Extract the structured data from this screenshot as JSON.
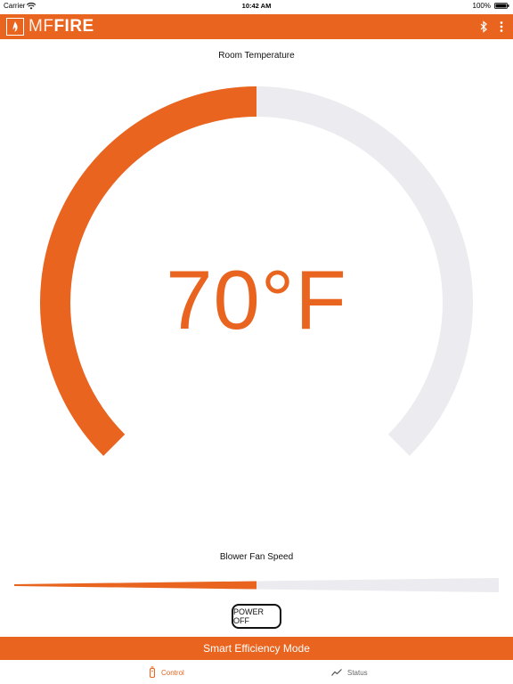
{
  "status_bar": {
    "carrier": "Carrier",
    "time": "10:42 AM",
    "battery": "100%"
  },
  "header": {
    "logo_mf": "MF",
    "logo_fire": "FIRE",
    "icons": [
      "flame-logo-icon",
      "bluetooth-icon",
      "more-vertical-icon"
    ]
  },
  "thermostat": {
    "label": "Room Temperature",
    "temperature": "70°F",
    "dial_fill_fraction": 0.5
  },
  "fan": {
    "label": "Blower Fan Speed",
    "fill_fraction": 0.5
  },
  "power_button": {
    "label": "POWER OFF"
  },
  "smart_bar": {
    "label": "Smart Efficiency Mode"
  },
  "tabs": [
    {
      "label": "Control",
      "icon": "remote-icon",
      "active": true
    },
    {
      "label": "Status",
      "icon": "trend-line-icon",
      "active": false
    }
  ],
  "colors": {
    "accent": "#e8641f",
    "track": "#ebebf0"
  }
}
